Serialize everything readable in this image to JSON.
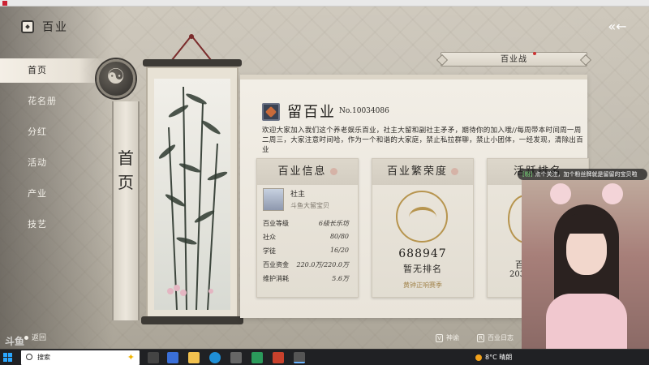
{
  "window": {
    "title": ""
  },
  "header": {
    "title": "百业",
    "back_icon": "double-chevron-left-icon"
  },
  "sidebar": {
    "items": [
      {
        "label": "首页",
        "active": true
      },
      {
        "label": "花名册",
        "active": false
      },
      {
        "label": "分红",
        "active": false
      },
      {
        "label": "活动",
        "active": false
      },
      {
        "label": "产业",
        "active": false
      },
      {
        "label": "技艺",
        "active": false
      }
    ],
    "return_label": "返回"
  },
  "plaque": {
    "text": "首页"
  },
  "tabs": {
    "guild_war_label": "百业战"
  },
  "guild": {
    "name": "留百业",
    "number": "No.10034086",
    "description": "欢迎大家加入我们这个养老娱乐百业，社主大留和副社主矛矛，期待你的加入哦//每周带本时间周一周二周三，大家注意时间哈，作为一个和谐的大家庭，禁止私拉群聊，禁止小团体，一经发现，清除出百业"
  },
  "info_card": {
    "title": "百业信息",
    "leader_label": "社主",
    "leader_name": "斗鱼大留宝贝",
    "stats": [
      {
        "key": "百业等级",
        "value": "6级长乐坊"
      },
      {
        "key": "社众",
        "value": "80/80"
      },
      {
        "key": "学徒",
        "value": "16/20"
      },
      {
        "key": "百业资金",
        "value": "220.0万/220.0万"
      },
      {
        "key": "维护消耗",
        "value": "5.6万"
      }
    ]
  },
  "prosperity_card": {
    "title": "百业繁荣度",
    "value": "688947",
    "rank": "暂无排名",
    "season": "黄钟正响赛季"
  },
  "third_card": {
    "title": "活跃排名",
    "text_b": "百",
    "text_c": "203"
  },
  "footer_hints": [
    {
      "key": "V",
      "label": "神谕"
    },
    {
      "key": "R",
      "label": "百业日志"
    }
  ],
  "overlay": {
    "tag": "[粉]",
    "text": "点个关注，加个粉丝牌就是留留的宝贝啦"
  },
  "taskbar": {
    "search_placeholder": "搜索",
    "temperature": "8°C",
    "weather": "晴朗"
  },
  "colors": {
    "paper": "#ebe6dc",
    "ink": "#2b2926",
    "gold": "#b7954f",
    "accent_red": "#c33333"
  },
  "watermark": "斗鱼"
}
